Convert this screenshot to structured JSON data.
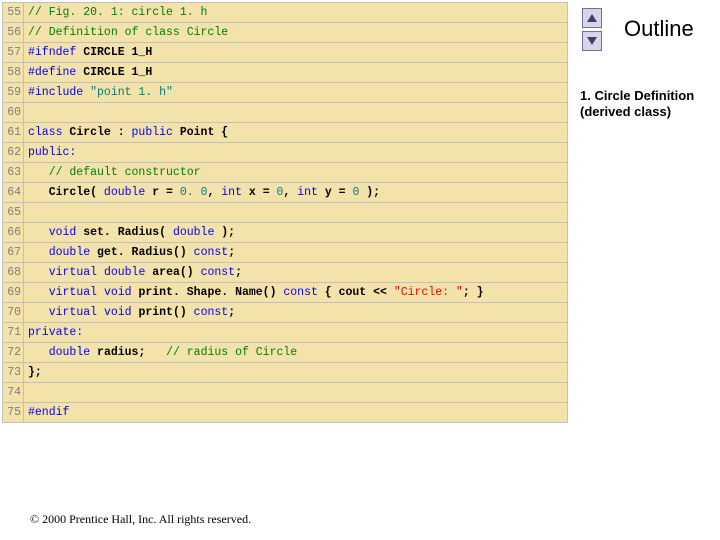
{
  "sidebar": {
    "title": "Outline",
    "note": "1. Circle Definition (derived class)"
  },
  "nav": {
    "up_name": "nav-up",
    "down_name": "nav-down"
  },
  "copyright": "© 2000 Prentice Hall, Inc. All rights reserved.",
  "code": {
    "lines": [
      {
        "no": "55",
        "frags": [
          {
            "t": "// Fig. 20. 1: circle 1. h",
            "cls": "c-green"
          }
        ]
      },
      {
        "no": "56",
        "frags": [
          {
            "t": "// Definition of class Circle",
            "cls": "c-green"
          }
        ]
      },
      {
        "no": "57",
        "frags": [
          {
            "t": "#ifndef",
            "cls": "c-blue"
          },
          {
            "t": " CIRCLE 1_H",
            "cls": "c-black b"
          }
        ]
      },
      {
        "no": "58",
        "frags": [
          {
            "t": "#define",
            "cls": "c-blue"
          },
          {
            "t": " CIRCLE 1_H",
            "cls": "c-black b"
          }
        ]
      },
      {
        "no": "59",
        "frags": [
          {
            "t": "#include",
            "cls": "c-blue"
          },
          {
            "t": " \"point 1. h\"",
            "cls": "c-teal"
          }
        ]
      },
      {
        "no": "60",
        "frags": [
          {
            "t": " ",
            "cls": "c-black"
          }
        ]
      },
      {
        "no": "61",
        "frags": [
          {
            "t": "class",
            "cls": "c-blue"
          },
          {
            "t": " Circle : ",
            "cls": "c-black b"
          },
          {
            "t": "public",
            "cls": "c-blue"
          },
          {
            "t": " Point {",
            "cls": "c-black b"
          }
        ]
      },
      {
        "no": "62",
        "frags": [
          {
            "t": "public:",
            "cls": "c-blue"
          }
        ]
      },
      {
        "no": "63",
        "frags": [
          {
            "t": "   // default constructor",
            "cls": "c-green"
          }
        ]
      },
      {
        "no": "64",
        "frags": [
          {
            "t": "   Circle( ",
            "cls": "c-black b"
          },
          {
            "t": "double",
            "cls": "c-blue"
          },
          {
            "t": " r = ",
            "cls": "c-black b"
          },
          {
            "t": "0. 0",
            "cls": "c-teal"
          },
          {
            "t": ", ",
            "cls": "c-black b"
          },
          {
            "t": "int",
            "cls": "c-blue"
          },
          {
            "t": " x = ",
            "cls": "c-black b"
          },
          {
            "t": "0",
            "cls": "c-teal"
          },
          {
            "t": ", ",
            "cls": "c-black b"
          },
          {
            "t": "int",
            "cls": "c-blue"
          },
          {
            "t": " y = ",
            "cls": "c-black b"
          },
          {
            "t": "0",
            "cls": "c-teal"
          },
          {
            "t": " );",
            "cls": "c-black b"
          }
        ]
      },
      {
        "no": "65",
        "frags": [
          {
            "t": " ",
            "cls": "c-black"
          }
        ]
      },
      {
        "no": "66",
        "frags": [
          {
            "t": "   ",
            "cls": "c-black"
          },
          {
            "t": "void",
            "cls": "c-blue"
          },
          {
            "t": " set. Radius( ",
            "cls": "c-black b"
          },
          {
            "t": "double",
            "cls": "c-blue"
          },
          {
            "t": " );",
            "cls": "c-black b"
          }
        ]
      },
      {
        "no": "67",
        "frags": [
          {
            "t": "   ",
            "cls": "c-black"
          },
          {
            "t": "double",
            "cls": "c-blue"
          },
          {
            "t": " get. Radius() ",
            "cls": "c-black b"
          },
          {
            "t": "const",
            "cls": "c-blue"
          },
          {
            "t": ";",
            "cls": "c-black b"
          }
        ]
      },
      {
        "no": "68",
        "frags": [
          {
            "t": "   ",
            "cls": "c-black"
          },
          {
            "t": "virtual",
            "cls": "c-blue"
          },
          {
            "t": " ",
            "cls": "c-black"
          },
          {
            "t": "double",
            "cls": "c-blue"
          },
          {
            "t": " area() ",
            "cls": "c-black b"
          },
          {
            "t": "const",
            "cls": "c-blue"
          },
          {
            "t": ";",
            "cls": "c-black b"
          }
        ]
      },
      {
        "no": "69",
        "frags": [
          {
            "t": "   ",
            "cls": "c-black"
          },
          {
            "t": "virtual",
            "cls": "c-blue"
          },
          {
            "t": " ",
            "cls": "c-black"
          },
          {
            "t": "void",
            "cls": "c-blue"
          },
          {
            "t": " print. Shape. Name() ",
            "cls": "c-black b"
          },
          {
            "t": "const",
            "cls": "c-blue"
          },
          {
            "t": " { cout << ",
            "cls": "c-black b"
          },
          {
            "t": "\"Circle: \"",
            "cls": "c-red"
          },
          {
            "t": "; }",
            "cls": "c-black b"
          }
        ]
      },
      {
        "no": "70",
        "frags": [
          {
            "t": "   ",
            "cls": "c-black"
          },
          {
            "t": "virtual",
            "cls": "c-blue"
          },
          {
            "t": " ",
            "cls": "c-black"
          },
          {
            "t": "void",
            "cls": "c-blue"
          },
          {
            "t": " print() ",
            "cls": "c-black b"
          },
          {
            "t": "const",
            "cls": "c-blue"
          },
          {
            "t": ";",
            "cls": "c-black b"
          }
        ]
      },
      {
        "no": "71",
        "frags": [
          {
            "t": "private:",
            "cls": "c-blue"
          }
        ]
      },
      {
        "no": "72",
        "frags": [
          {
            "t": "   ",
            "cls": "c-black"
          },
          {
            "t": "double",
            "cls": "c-blue"
          },
          {
            "t": " radius;   ",
            "cls": "c-black b"
          },
          {
            "t": "// radius of Circle",
            "cls": "c-green"
          }
        ]
      },
      {
        "no": "73",
        "frags": [
          {
            "t": "};",
            "cls": "c-black b"
          }
        ]
      },
      {
        "no": "74",
        "frags": [
          {
            "t": " ",
            "cls": "c-black"
          }
        ]
      },
      {
        "no": "75",
        "frags": [
          {
            "t": "#endif",
            "cls": "c-blue"
          }
        ]
      }
    ]
  }
}
